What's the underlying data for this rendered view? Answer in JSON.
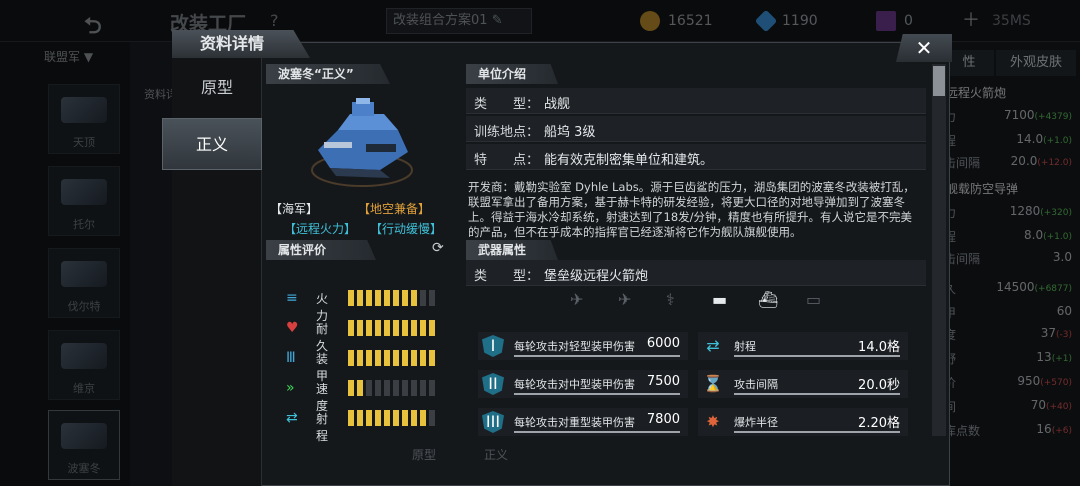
{
  "header": {
    "title": "改装工厂",
    "help": "?",
    "plan_name": "改装组合方案01",
    "gold": "16521",
    "diamond": "1190",
    "card": "0",
    "time": "35MS"
  },
  "sidebar": {
    "faction": "联盟军",
    "detail_label": "资料详",
    "units": [
      {
        "label": "天顶"
      },
      {
        "label": "托尔"
      },
      {
        "label": "伐尔特"
      },
      {
        "label": "维京"
      },
      {
        "label": "波塞冬"
      }
    ]
  },
  "right_panel": {
    "tabs": [
      "性",
      "外观皮肤"
    ],
    "weapon1_title": "远程火箭炮",
    "weapon2_title": "舰载防空导弹",
    "rows": [
      {
        "label": "力",
        "value": "7100",
        "delta": "(+4379)",
        "pos": "g"
      },
      {
        "label": "程",
        "value": "14.0",
        "delta": "(+1.0)",
        "pos": "g"
      },
      {
        "label": "击间隔",
        "value": "20.0",
        "delta": "(+12.0)",
        "pos": "r"
      },
      {
        "label": "力",
        "value": "1280",
        "delta": "(+320)",
        "pos": "g"
      },
      {
        "label": "程",
        "value": "8.0",
        "delta": "(+1.0)",
        "pos": "g"
      },
      {
        "label": "击间隔",
        "value": "3.0",
        "delta": "",
        "pos": "g"
      },
      {
        "label": "久",
        "value": "14500",
        "delta": "(+6877)",
        "pos": "g"
      },
      {
        "label": "甲",
        "value": "60",
        "delta": "",
        "pos": "g"
      },
      {
        "label": "度",
        "value": "37",
        "delta": "(-3)",
        "pos": "r"
      },
      {
        "label": "野",
        "value": "13",
        "delta": "(+1)",
        "pos": "g"
      },
      {
        "label": "价",
        "value": "950",
        "delta": "(+570)",
        "pos": "r"
      },
      {
        "label": "间",
        "value": "70",
        "delta": "(+40)",
        "pos": "r"
      },
      {
        "label": "库点数",
        "value": "16",
        "delta": "(+6)",
        "pos": "r"
      }
    ]
  },
  "modal": {
    "title": "资料详情",
    "close": "✕",
    "tabs": [
      {
        "label": "原型"
      },
      {
        "label": "正义"
      }
    ],
    "unit_name": "波塞冬“正义”",
    "tags": {
      "navy": "【海军】",
      "air": "【地空兼备】",
      "fire": "【远程火力】",
      "slow": "【行动缓慢】"
    },
    "attr_title": "属性评价",
    "stats": [
      {
        "label": "火力",
        "value": 8,
        "max": 10
      },
      {
        "label": "耐久",
        "value": 10,
        "max": 10
      },
      {
        "label": "装甲",
        "value": 10,
        "max": 10
      },
      {
        "label": "速度",
        "value": 2,
        "max": 10
      },
      {
        "label": "射程",
        "value": 9,
        "max": 10
      }
    ],
    "intro_title": "单位介绍",
    "intro": [
      {
        "key": "类　　型：",
        "value": "战舰"
      },
      {
        "key": "训练地点：",
        "value": "船坞 3级"
      },
      {
        "key": "特　　点：",
        "value": "能有效克制密集单位和建筑。"
      }
    ],
    "description": "开发商：戴勒实验室 Dyhle Labs。源于巨齿鲨的压力，湖岛集团的波塞冬改装被打乱，联盟军拿出了备用方案，基于赫卡特的研发经验，将更大口径的对地导弹加到了波塞冬上。得益于海水冷却系统，射速达到了18发/分钟，精度也有所提升。有人说它是不完美的产品，但不在乎成本的指挥官已经逐渐将它作为舰队旗舰使用。",
    "weapon_title": "武器属性",
    "weapon_type_key": "类　　型：",
    "weapon_type": "堡垒级远程火箭炮",
    "weapon_stats": [
      {
        "label": "每轮攻击对轻型装甲伤害",
        "value": "6000"
      },
      {
        "label": "射程",
        "value": "14.0格"
      },
      {
        "label": "每轮攻击对中型装甲伤害",
        "value": "7500"
      },
      {
        "label": "攻击间隔",
        "value": "20.0秒"
      },
      {
        "label": "每轮攻击对重型装甲伤害",
        "value": "7800"
      },
      {
        "label": "爆炸半径",
        "value": "2.20格"
      }
    ],
    "bottom_tabs": [
      "原型",
      "正义"
    ]
  }
}
